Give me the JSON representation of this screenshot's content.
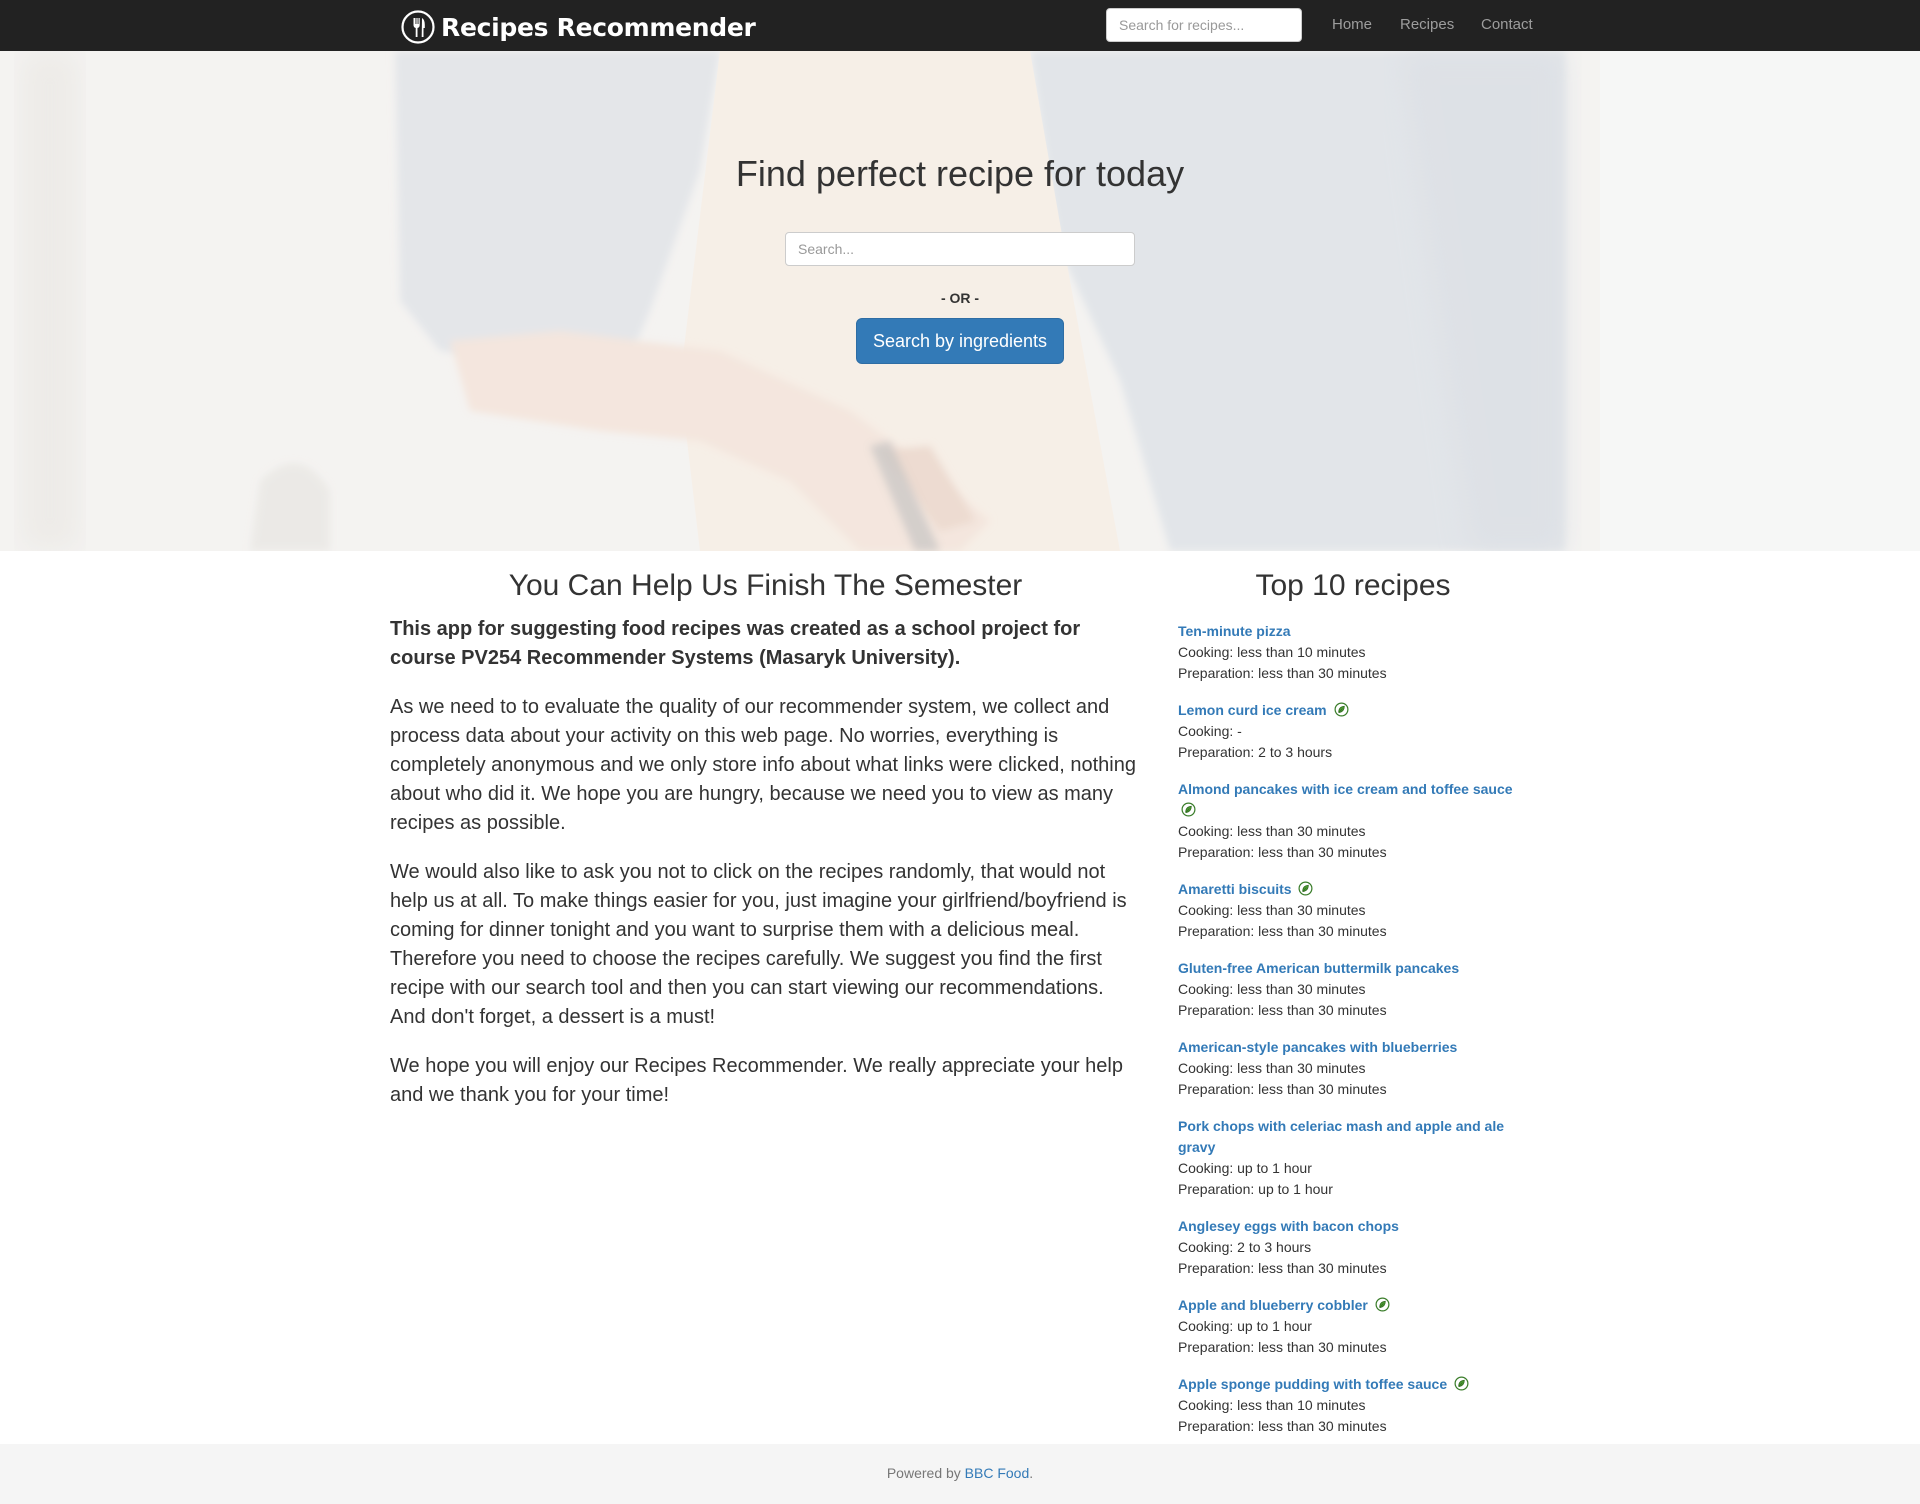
{
  "navbar": {
    "brand": "Recipes Recommender",
    "logo_icon": "fork-plate-icon",
    "search_placeholder": "Search for recipes...",
    "links": [
      "Home",
      "Recipes",
      "Contact"
    ]
  },
  "hero": {
    "title": "Find perfect recipe for today",
    "search_placeholder": "Search...",
    "or_text": "- OR -",
    "button_label": "Search by ingredients"
  },
  "about": {
    "title": "You Can Help Us Finish The Semester",
    "lead": "This app for suggesting food recipes was created as a school project for course PV254 Recommender Systems (Masaryk University).",
    "paragraphs": [
      "As we need to to evaluate the quality of our recommender system, we collect and process data about your activity on this web page. No worries, everything is completely anonymous and we only store info about what links were clicked, nothing about who did it. We hope you are hungry, because we need you to view as many recipes as possible.",
      "We would also like to ask you not to click on the recipes randomly, that would not help us at all. To make things easier for you, just imagine your girlfriend/boyfriend is coming for dinner tonight and you want to surprise them with a delicious meal. Therefore you need to choose the recipes carefully. We suggest you find the first recipe with our search tool and then you can start viewing our recommendations. And don't forget, a dessert is a must!",
      "We hope you will enjoy our Recipes Recommender. We really appreciate your help and we thank you for your time!"
    ]
  },
  "top": {
    "title": "Top 10 recipes",
    "recipes": [
      {
        "name": "Ten-minute pizza",
        "vegetarian": false,
        "cooking": "Cooking: less than 10 minutes",
        "preparation": "Preparation: less than 30 minutes"
      },
      {
        "name": "Lemon curd ice cream",
        "vegetarian": true,
        "cooking": "Cooking: -",
        "preparation": "Preparation: 2 to 3 hours"
      },
      {
        "name": "Almond pancakes with ice cream and toffee sauce",
        "vegetarian": true,
        "cooking": "Cooking: less than 30 minutes",
        "preparation": "Preparation: less than 30 minutes"
      },
      {
        "name": "Amaretti biscuits",
        "vegetarian": true,
        "cooking": "Cooking: less than 30 minutes",
        "preparation": "Preparation: less than 30 minutes"
      },
      {
        "name": "Gluten-free American buttermilk pancakes",
        "vegetarian": false,
        "cooking": "Cooking: less than 30 minutes",
        "preparation": "Preparation: less than 30 minutes"
      },
      {
        "name": "American-style pancakes with blueberries",
        "vegetarian": false,
        "cooking": "Cooking: less than 30 minutes",
        "preparation": "Preparation: less than 30 minutes"
      },
      {
        "name": "Pork chops with celeriac mash and apple and ale gravy",
        "vegetarian": false,
        "cooking": "Cooking: up to 1 hour",
        "preparation": "Preparation: up to 1 hour"
      },
      {
        "name": "Anglesey eggs with bacon chops",
        "vegetarian": false,
        "cooking": "Cooking: 2 to 3 hours",
        "preparation": "Preparation: less than 30 minutes"
      },
      {
        "name": "Apple and blueberry cobbler",
        "vegetarian": true,
        "cooking": "Cooking: up to 1 hour",
        "preparation": "Preparation: less than 30 minutes"
      },
      {
        "name": "Apple sponge pudding with toffee sauce",
        "vegetarian": true,
        "cooking": "Cooking: less than 10 minutes",
        "preparation": "Preparation: less than 30 minutes"
      }
    ],
    "vegetarian_icon": "vegetarian-leaf-icon"
  },
  "footer": {
    "prefix": "Powered by ",
    "link_text": "BBC Food",
    "suffix": "."
  },
  "colors": {
    "navbar_bg": "#222222",
    "link": "#337ab7",
    "primary_button": "#337ab7",
    "footer_bg": "#f5f5f5"
  }
}
